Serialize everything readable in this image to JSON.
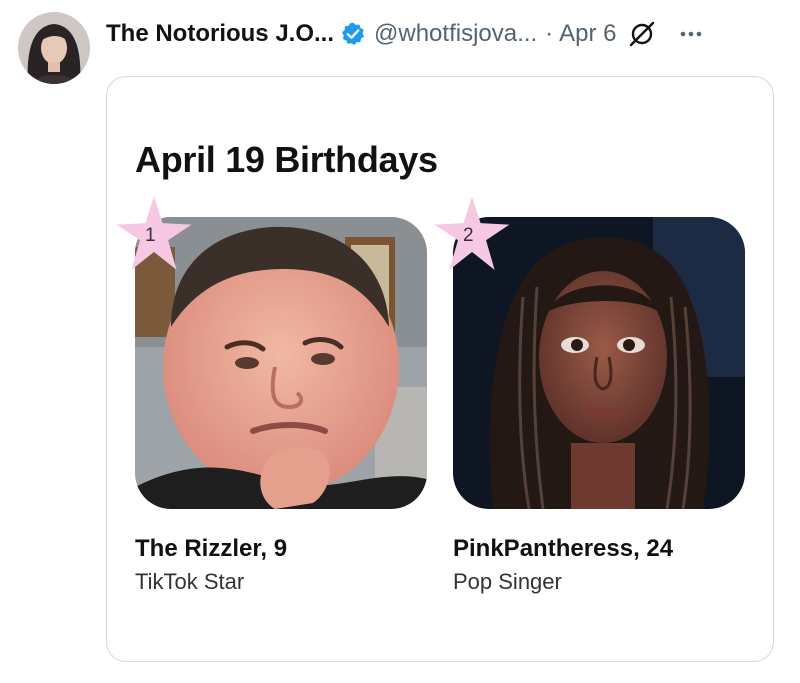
{
  "post": {
    "author_name": "The Notorious J.O...",
    "handle": "@whotfisjova...",
    "separator": "·",
    "date": "Apr 6"
  },
  "icons": {
    "verified": "verified-badge-icon",
    "grok": "grok-icon",
    "more": "more-options-icon"
  },
  "colors": {
    "verified_blue": "#1d9bf0",
    "secondary_text": "#536471",
    "star_pink": "#f7c8e4"
  },
  "card": {
    "title": "April 19 Birthdays",
    "people": [
      {
        "rank": "1",
        "name": "The Rizzler, 9",
        "role": "TikTok Star"
      },
      {
        "rank": "2",
        "name": "PinkPantheress, 24",
        "role": "Pop Singer"
      }
    ]
  }
}
